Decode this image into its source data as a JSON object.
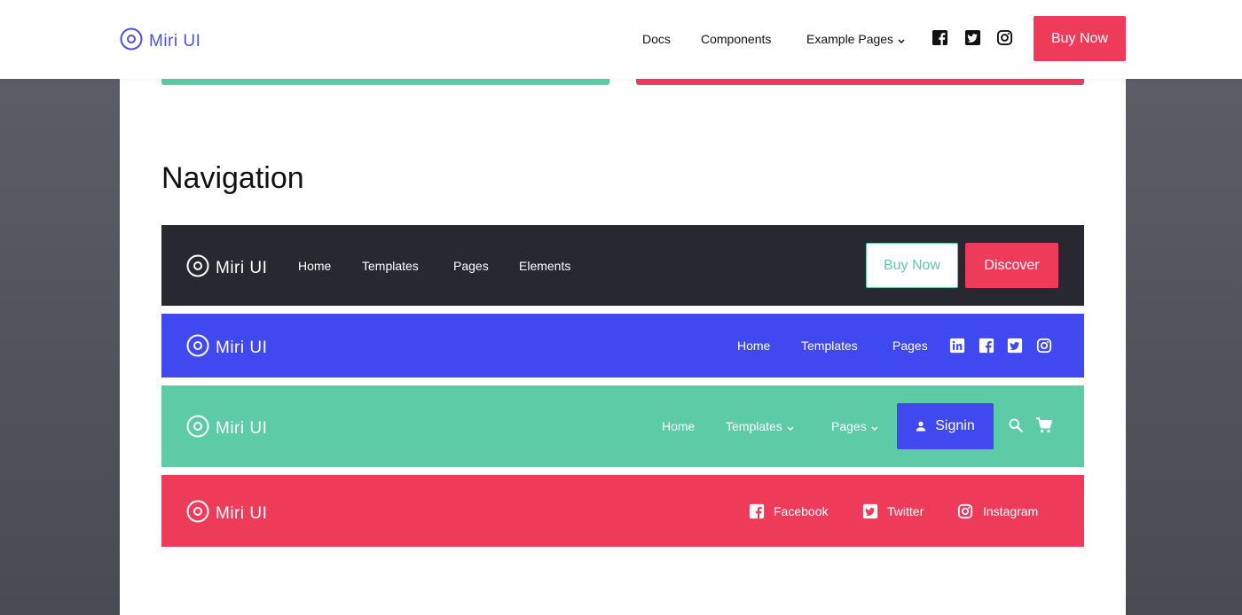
{
  "brand": {
    "name": "Miri UI",
    "logo_icon": "target-circle-icon"
  },
  "colors": {
    "primary": "#4b50e6",
    "blue": "#4048ef",
    "green": "#5ccba6",
    "red": "#ef3b5a",
    "dark": "#282830"
  },
  "header": {
    "nav": [
      "Docs",
      "Components",
      "Example Pages"
    ],
    "dropdown_icon": "chevron-down-icon",
    "social_icons": [
      "facebook-icon",
      "twitter-icon",
      "instagram-icon"
    ],
    "buy_label": "Buy Now"
  },
  "section": {
    "title": "Navigation"
  },
  "navbar_dark": {
    "links": [
      "Home",
      "Templates",
      "Pages",
      "Elements"
    ],
    "buy_label": "Buy Now",
    "discover_label": "Discover"
  },
  "navbar_blue": {
    "links": [
      "Home",
      "Templates",
      "Pages"
    ],
    "social_icons": [
      "linkedin-icon",
      "facebook-icon",
      "twitter-icon",
      "instagram-icon"
    ]
  },
  "navbar_green": {
    "links": [
      "Home",
      "Templates",
      "Pages"
    ],
    "signin_label": "Signin",
    "icons": [
      "user-icon",
      "search-icon",
      "cart-icon"
    ]
  },
  "navbar_red": {
    "social": [
      {
        "icon": "facebook-icon",
        "label": "Facebook"
      },
      {
        "icon": "twitter-icon",
        "label": "Twitter"
      },
      {
        "icon": "instagram-icon",
        "label": "Instagram"
      }
    ]
  }
}
